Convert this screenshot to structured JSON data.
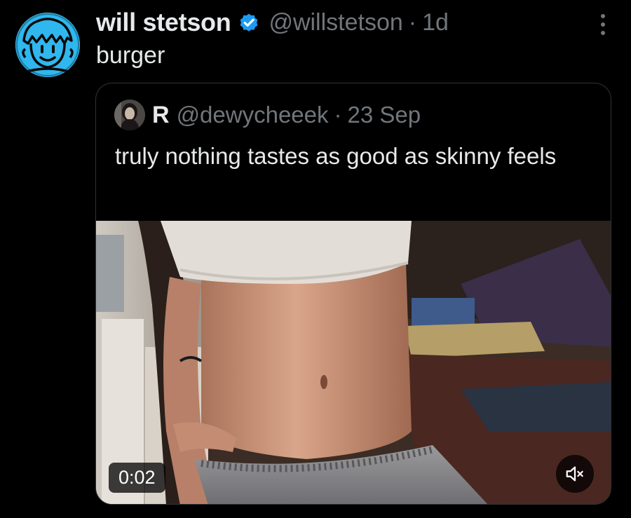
{
  "tweet": {
    "author": {
      "display_name": "will stetson",
      "handle": "@willstetson",
      "verified": true
    },
    "separator": "·",
    "time": "1d",
    "text": "burger",
    "menu_icon": "more-vertical-icon"
  },
  "quoted_tweet": {
    "author": {
      "display_name": "R",
      "handle": "@dewycheeek"
    },
    "separator": "·",
    "time": "23 Sep",
    "text": "truly nothing tastes as good as skinny feels",
    "media": {
      "type": "video",
      "duration": "0:02",
      "muted": true,
      "mute_icon": "speaker-muted-icon"
    }
  },
  "colors": {
    "background": "#000000",
    "primary_text": "#e7e9ea",
    "secondary_text": "#71767b",
    "verified_badge": "#1d9bf0",
    "border": "#2f3336",
    "avatar_bg": "#2fb7ee"
  }
}
